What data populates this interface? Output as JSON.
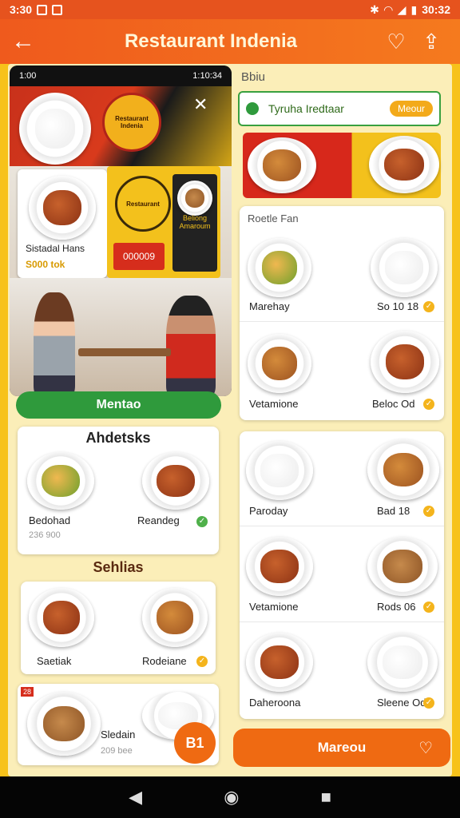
{
  "status_bar": {
    "time": "3:30",
    "right": "30:32"
  },
  "app_bar": {
    "title": "Restaurant Indenia",
    "back_icon": "←",
    "favorite_icon": "♡",
    "share_icon": "⇪"
  },
  "phone": {
    "status_left": "1:00",
    "status_right": "1:10:34",
    "logo_text": "Restaurant Indenia",
    "logo2_text": "Restaurant",
    "card1_name": "Sistadal Hans",
    "card1_price": "S000 tok",
    "card2_button": "000009",
    "card2_label": "Beliong Amaroum"
  },
  "green_button": "Mentao",
  "left_section1": {
    "title": "Ahdetsks",
    "items": [
      {
        "name": "Bedohad",
        "sub": "236 900"
      },
      {
        "name": "Reandeg",
        "sub": ""
      }
    ]
  },
  "left_section2": {
    "title": "Sehlias",
    "items": [
      {
        "name": "Saetiak"
      },
      {
        "name": "Rodeiane"
      }
    ]
  },
  "left_section3": {
    "name": "Sledain",
    "sub": "209 bee",
    "badge": "B1",
    "tag": "28"
  },
  "right_top": {
    "label": "Bbiu",
    "search_text": "Tyruha Iredtaar",
    "search_button": "Meour"
  },
  "right_list1": {
    "title": "Roetle Fan",
    "items": [
      {
        "name": "Marehay",
        "value": "So 10 18"
      },
      {
        "name": "Vetamione",
        "value": "Beloc Od"
      }
    ]
  },
  "right_list2": {
    "items": [
      {
        "name": "Paroday",
        "value": "Bad 18"
      },
      {
        "name": "Vetamione",
        "value": "Rods 06"
      },
      {
        "name": "Daheroona",
        "value": "Sleene Od"
      }
    ]
  },
  "orange_button": {
    "label": "Mareou",
    "icon": "heart-icon"
  },
  "colors": {
    "accent": "#ef6a12",
    "green": "#2f9a3c",
    "yellow": "#f7c21a"
  }
}
